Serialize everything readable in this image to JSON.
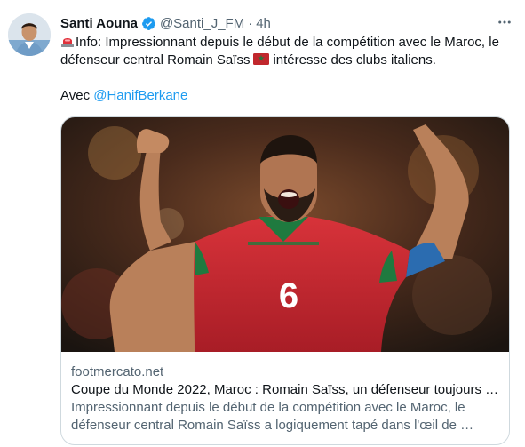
{
  "tweet": {
    "author_name": "Santi Aouna",
    "author_handle": "@Santi_J_FM",
    "separator": "·",
    "timestamp": "4h",
    "line1": "Info: Impressionnant depuis le début de la compétition avec le Maroc, le",
    "line2_before_flag": "défenseur central Romain Saïss",
    "line2_after_flag": "intéresse des clubs italiens.",
    "line3_prefix": "Avec ",
    "mention": "@HanifBerkane",
    "icons": {
      "verified": "verified-badge-icon",
      "more": "more-options-icon",
      "siren": "police-light-emoji-icon",
      "flag": "morocco-flag-emoji-icon"
    }
  },
  "card": {
    "domain": "footmercato.net",
    "title": "Coupe du Monde 2022, Maroc : Romain Saïss, un défenseur toujours …",
    "description_line1": "Impressionnant depuis le début de la compétition avec le Maroc, le",
    "description_line2": "défenseur central Romain Saïss a logiquement tapé dans l'œil de …",
    "jersey_number": "6"
  },
  "colors": {
    "text": "#0f1419",
    "secondary": "#536471",
    "link": "#1d9bf0",
    "border": "#cfd9de",
    "jersey_red": "#c8232c",
    "jersey_green": "#1f7a3f"
  }
}
